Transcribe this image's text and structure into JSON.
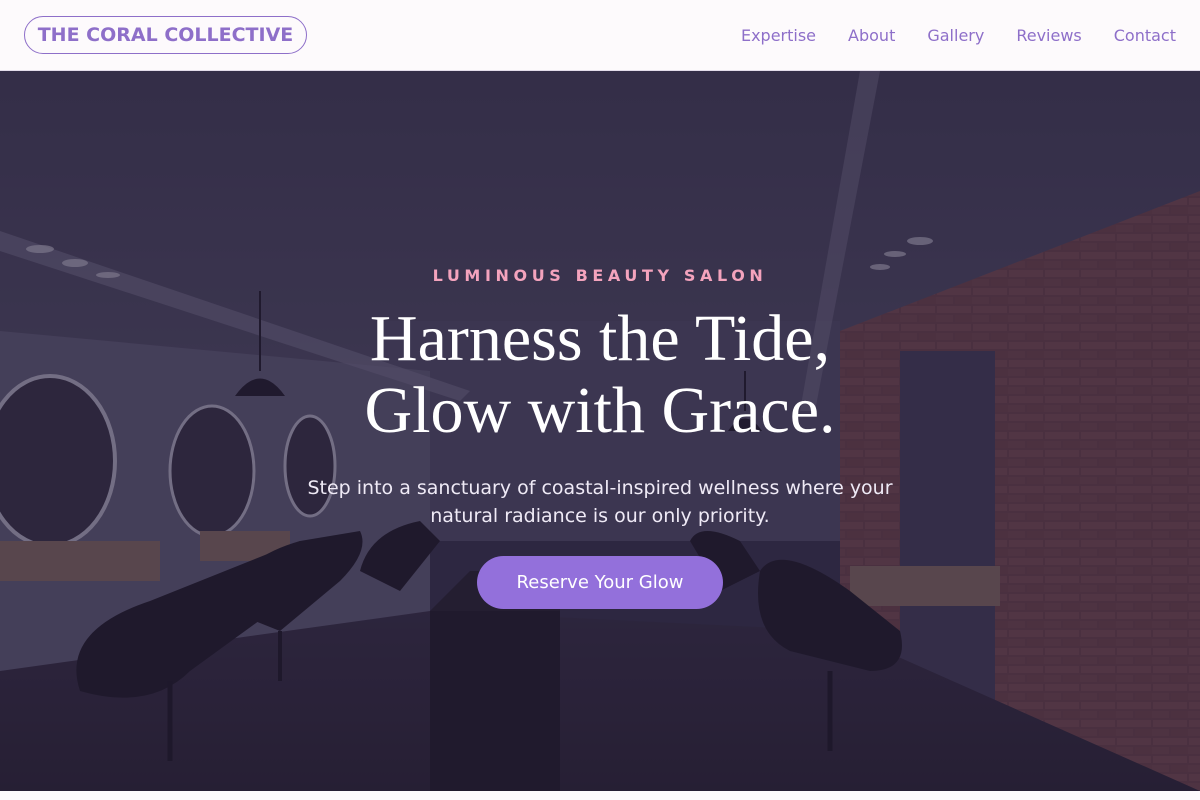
{
  "header": {
    "logo_text": "THE CORAL COLLECTIVE",
    "nav": [
      {
        "label": "Expertise"
      },
      {
        "label": "About"
      },
      {
        "label": "Gallery"
      },
      {
        "label": "Reviews"
      },
      {
        "label": "Contact"
      }
    ]
  },
  "hero": {
    "eyebrow": "LUMINOUS BEAUTY SALON",
    "headline_line1": "Harness the Tide,",
    "headline_line2": "Glow with Grace.",
    "subtext": "Step into a sanctuary of coastal-inspired wellness where your natural radiance is our only priority.",
    "cta_label": "Reserve Your Glow",
    "background_image": "salon-interior-photo"
  },
  "colors": {
    "accent": "#9370db",
    "logo_text": "#8e6fc9",
    "eyebrow": "#f4a3bd",
    "header_bg": "#fdfafc"
  }
}
